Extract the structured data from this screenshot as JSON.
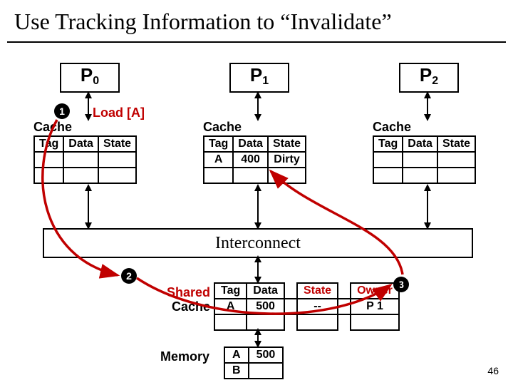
{
  "title": "Use Tracking Information to “Invalidate”",
  "pageNumber": "46",
  "processors": {
    "p0": {
      "name": "P",
      "sub": "0"
    },
    "p1": {
      "name": "P",
      "sub": "1"
    },
    "p2": {
      "name": "P",
      "sub": "2"
    }
  },
  "steps": {
    "one": "1",
    "two": "2",
    "three": "3"
  },
  "loadOp": "Load [A]",
  "cacheLabel": "Cache",
  "headers": {
    "tag": "Tag",
    "data": "Data",
    "state": "State",
    "owner": "Owner"
  },
  "cache0": {
    "row": {
      "tag": "",
      "data": "",
      "state": ""
    }
  },
  "cache1": {
    "row": {
      "tag": "A",
      "data": "400",
      "state": "Dirty"
    }
  },
  "cache2": {
    "row": {
      "tag": "",
      "data": "",
      "state": ""
    }
  },
  "interconnect": "Interconnect",
  "sharedCacheLabelLine1": "Shared",
  "sharedCacheLabelLine2": "Cache",
  "sharedCache": {
    "row": {
      "tag": "A",
      "data": "500",
      "state": "--",
      "owner": "P 1"
    }
  },
  "memoryLabel": "Memory",
  "memory": {
    "r0": {
      "tag": "A",
      "data": "500"
    },
    "r1": {
      "tag": "B",
      "data": ""
    }
  }
}
